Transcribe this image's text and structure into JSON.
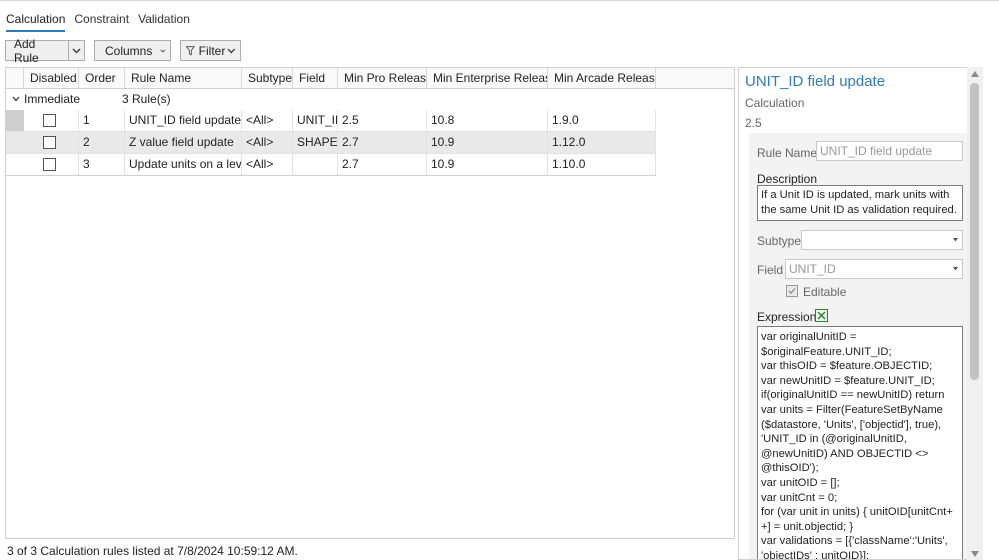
{
  "tabs": [
    {
      "label": "Calculation"
    },
    {
      "label": "Constraint"
    },
    {
      "label": "Validation"
    }
  ],
  "toolbar": {
    "add_rule_label": "Add Rule",
    "columns_label": "Columns",
    "filter_label": "Filter"
  },
  "grid": {
    "columns": [
      "Disabled",
      "Order",
      "Rule Name",
      "Subtype",
      "Field",
      "Min Pro Release",
      "Min Enterprise Release",
      "Min Arcade Release"
    ],
    "group": {
      "name": "Immediate",
      "count": "3 Rule(s)"
    },
    "rows": [
      {
        "order": "1",
        "rule_name": "UNIT_ID field update",
        "subtype": "<All>",
        "field": "UNIT_ID",
        "min_pro": "2.5",
        "min_enterprise": "10.8",
        "min_arcade": "1.9.0"
      },
      {
        "order": "2",
        "rule_name": "Z value field update",
        "subtype": "<All>",
        "field": "SHAPE",
        "min_pro": "2.7",
        "min_enterprise": "10.9",
        "min_arcade": "1.12.0"
      },
      {
        "order": "3",
        "rule_name": "Update units on a level",
        "subtype": "<All>",
        "field": "",
        "min_pro": "2.7",
        "min_enterprise": "10.9",
        "min_arcade": "1.10.0"
      }
    ]
  },
  "status": "3 of 3 Calculation rules listed at 7/8/2024 10:59:12 AM.",
  "panel": {
    "title": "UNIT_ID field update",
    "type": "Calculation",
    "version": "2.5",
    "rule_name_label": "Rule Name",
    "rule_name_placeholder": "UNIT_ID field update",
    "description_label": "Description",
    "description": "If a Unit ID is updated, mark units with the same Unit ID as validation required.",
    "subtype_label": "Subtype",
    "subtype_value": "",
    "field_label": "Field",
    "field_value": "UNIT_ID",
    "editable_label": "Editable",
    "expression_label": "Expression",
    "expression": "var originalUnitID =\n$originalFeature.UNIT_ID;\nvar thisOID = $feature.OBJECTID;\nvar newUnitID = $feature.UNIT_ID;\nif(originalUnitID == newUnitID) return\nvar units = Filter(FeatureSetByName\n($datastore, 'Units', ['objectid'], true),\n'UNIT_ID in (@originalUnitID,\n@newUnitID) AND OBJECTID <>\n@thisOID');\nvar unitOID = [];\nvar unitCnt = 0;\nfor (var unit in units) { unitOID[unitCnt+\n+] = unit.objectid; }\nvar validations = [{'className':'Units',\n'objectIDs' : unitOID}];"
  },
  "colors": {
    "accent": "#2f7bc0",
    "selected_row": "#e9e9e9"
  }
}
